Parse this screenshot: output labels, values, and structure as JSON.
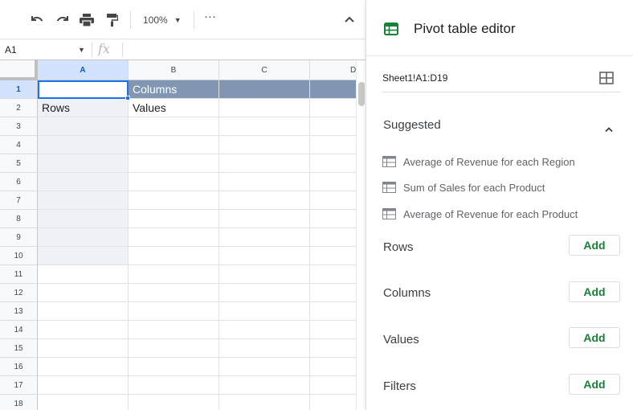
{
  "toolbar": {
    "zoom": "100%",
    "more": "···"
  },
  "formula_bar": {
    "cell_ref": "A1",
    "fx": "fx",
    "value": ""
  },
  "grid": {
    "columns": [
      "A",
      "B",
      "C",
      "D"
    ],
    "rows": [
      "1",
      "2",
      "3",
      "4",
      "5",
      "6",
      "7",
      "8",
      "9",
      "10",
      "11",
      "12",
      "13",
      "14",
      "15",
      "16",
      "17",
      "18"
    ],
    "cells": {
      "A1": "",
      "B1": "Columns",
      "A2": "Rows",
      "B2": "Values"
    },
    "colors": {
      "header_band": "#8096b3",
      "selection": "#1a73e8",
      "column_a_shade": "#eef1f6"
    }
  },
  "pivot_editor": {
    "title": "Pivot table editor",
    "data_range": "Sheet1!A1:D19",
    "suggested_label": "Suggested",
    "suggestions": [
      "Average of Revenue for each Region",
      "Sum of Sales for each Product",
      "Average of Revenue for each Product"
    ],
    "sections": [
      {
        "label": "Rows",
        "button": "Add"
      },
      {
        "label": "Columns",
        "button": "Add"
      },
      {
        "label": "Values",
        "button": "Add"
      },
      {
        "label": "Filters",
        "button": "Add"
      }
    ],
    "accent_color": "#188038"
  }
}
